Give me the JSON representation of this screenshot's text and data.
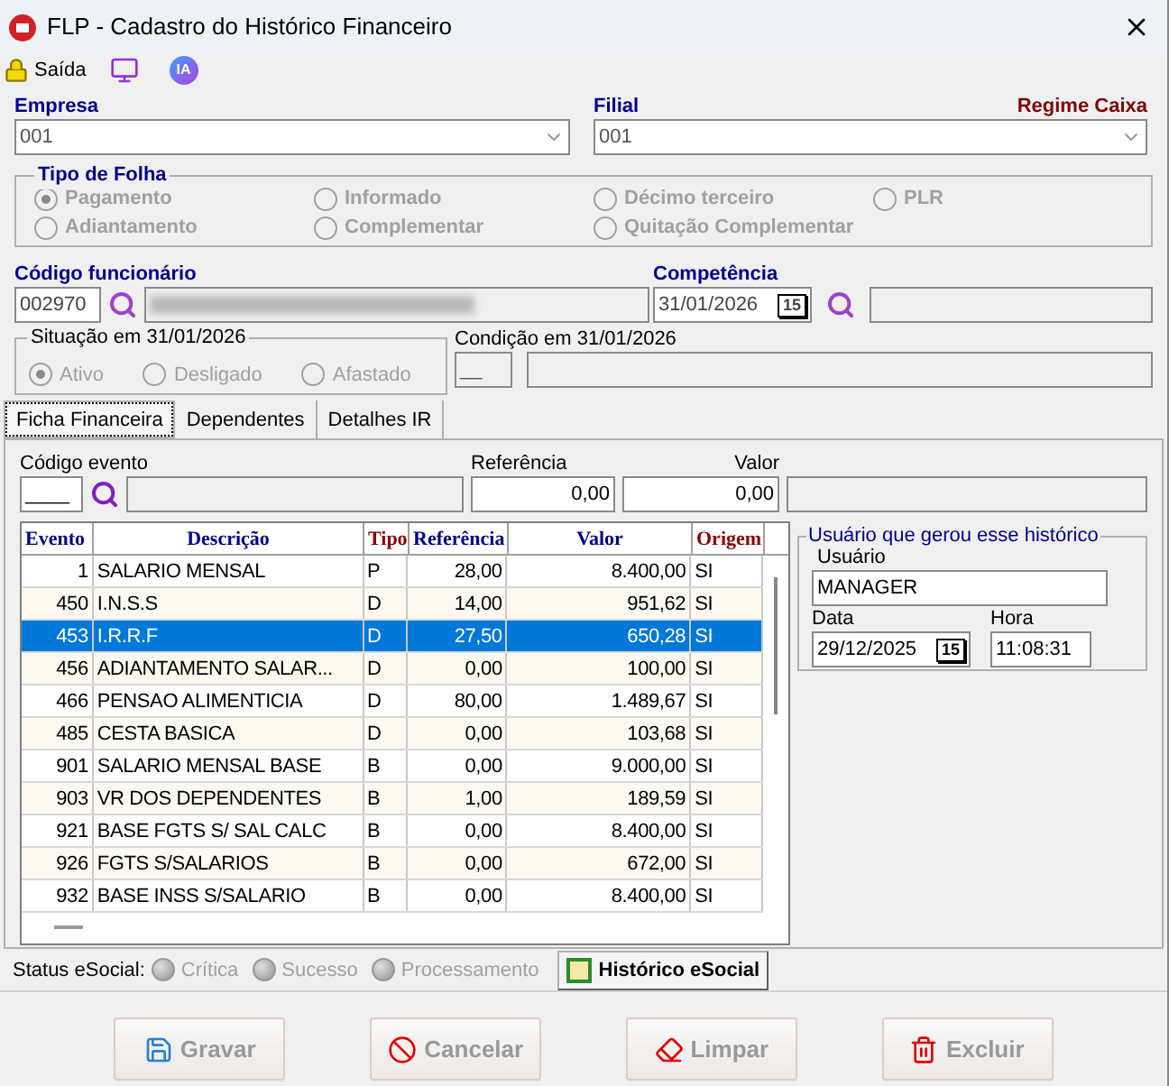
{
  "window": {
    "title": "FLP - Cadastro do Histórico Financeiro"
  },
  "toolbar": {
    "exit_label": "Saída",
    "ia_label": "IA"
  },
  "empresa": {
    "label": "Empresa",
    "value": "001"
  },
  "filial": {
    "label": "Filial",
    "value": "001",
    "regime": "Regime Caixa"
  },
  "tipo_folha": {
    "title": "Tipo de Folha",
    "options": [
      {
        "label": "Pagamento",
        "selected": true
      },
      {
        "label": "Informado",
        "selected": false
      },
      {
        "label": "Décimo terceiro",
        "selected": false
      },
      {
        "label": "PLR",
        "selected": false
      },
      {
        "label": "Adiantamento",
        "selected": false
      },
      {
        "label": "Complementar",
        "selected": false
      },
      {
        "label": "Quitação Complementar",
        "selected": false
      }
    ]
  },
  "funcionario": {
    "label": "Código funcionário",
    "code": "002970"
  },
  "competencia": {
    "label": "Competência",
    "value": "31/01/2026",
    "calendar": "15"
  },
  "situacao": {
    "title": "Situação em  31/01/2026",
    "options": [
      {
        "label": "Ativo",
        "selected": true
      },
      {
        "label": "Desligado",
        "selected": false
      },
      {
        "label": "Afastado",
        "selected": false
      }
    ]
  },
  "condicao": {
    "label": "Condição em 31/01/2026",
    "code": "__"
  },
  "tabs": [
    {
      "label": "Ficha Financeira",
      "selected": true
    },
    {
      "label": "Dependentes",
      "selected": false
    },
    {
      "label": "Detalhes IR",
      "selected": false
    }
  ],
  "evento_form": {
    "code_label": "Código evento",
    "code": "____",
    "referencia_label": "Referência",
    "referencia": "0,00",
    "valor_label": "Valor",
    "valor": "0,00"
  },
  "table": {
    "columns": [
      "Evento",
      "Descrição",
      "Tipo",
      "Referência",
      "Valor",
      "Origem"
    ],
    "rows": [
      {
        "cells": [
          "1",
          "SALARIO MENSAL",
          "P",
          "28,00",
          "8.400,00",
          "SI"
        ],
        "selected": false
      },
      {
        "cells": [
          "450",
          "I.N.S.S",
          "D",
          "14,00",
          "951,62",
          "SI"
        ],
        "selected": false
      },
      {
        "cells": [
          "453",
          "I.R.R.F",
          "D",
          "27,50",
          "650,28",
          "SI"
        ],
        "selected": true
      },
      {
        "cells": [
          "456",
          "ADIANTAMENTO SALAR...",
          "D",
          "0,00",
          "100,00",
          "SI"
        ],
        "selected": false
      },
      {
        "cells": [
          "466",
          "PENSAO ALIMENTICIA",
          "D",
          "80,00",
          "1.489,67",
          "SI"
        ],
        "selected": false
      },
      {
        "cells": [
          "485",
          "CESTA BASICA",
          "D",
          "0,00",
          "103,68",
          "SI"
        ],
        "selected": false
      },
      {
        "cells": [
          "901",
          "SALARIO MENSAL BASE",
          "B",
          "0,00",
          "9.000,00",
          "SI"
        ],
        "selected": false
      },
      {
        "cells": [
          "903",
          "VR DOS DEPENDENTES",
          "B",
          "1,00",
          "189,59",
          "SI"
        ],
        "selected": false
      },
      {
        "cells": [
          "921",
          "BASE FGTS S/ SAL CALC",
          "B",
          "0,00",
          "8.400,00",
          "SI"
        ],
        "selected": false
      },
      {
        "cells": [
          "926",
          "FGTS S/SALARIOS",
          "B",
          "0,00",
          "672,00",
          "SI"
        ],
        "selected": false
      },
      {
        "cells": [
          "932",
          "BASE INSS S/SALARIO",
          "B",
          "0,00",
          "8.400,00",
          "SI"
        ],
        "selected": false
      }
    ]
  },
  "usuario_box": {
    "title": "Usuário que gerou esse histórico",
    "usuario_label": "Usuário",
    "usuario": "MANAGER",
    "data_label": "Data",
    "data": "29/12/2025",
    "calendar": "15",
    "hora_label": "Hora",
    "hora": "11:08:31"
  },
  "status_esocial": {
    "label": "Status eSocial:",
    "options": [
      {
        "label": "Crítica",
        "selected": false
      },
      {
        "label": "Sucesso",
        "selected": false
      },
      {
        "label": "Processamento",
        "selected": false
      }
    ],
    "history_button": "Histórico eSocial"
  },
  "buttons": [
    {
      "kind": "save",
      "label": "Gravar"
    },
    {
      "kind": "cancel",
      "label": "Cancelar"
    },
    {
      "kind": "clear",
      "label": "Limpar"
    },
    {
      "kind": "delete",
      "label": "Excluir"
    }
  ]
}
